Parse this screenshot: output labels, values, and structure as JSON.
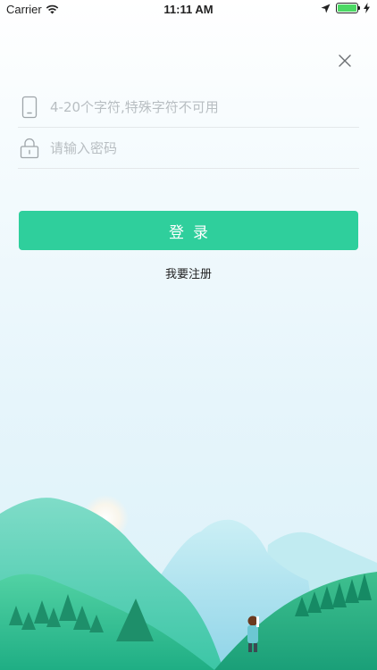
{
  "status_bar": {
    "carrier": "Carrier",
    "time": "11:11 AM"
  },
  "login_form": {
    "phone_placeholder": "4-20个字符,特殊字符不可用",
    "password_placeholder": "请输入密码",
    "login_label": "登录",
    "register_label": "我要注册"
  },
  "colors": {
    "accent": "#2fcf9c",
    "background": "#e6f5fb"
  },
  "icons": [
    "wifi-icon",
    "location-arrow-icon",
    "battery-icon",
    "charging-bolt-icon",
    "close-icon",
    "phone-icon",
    "lock-icon"
  ]
}
